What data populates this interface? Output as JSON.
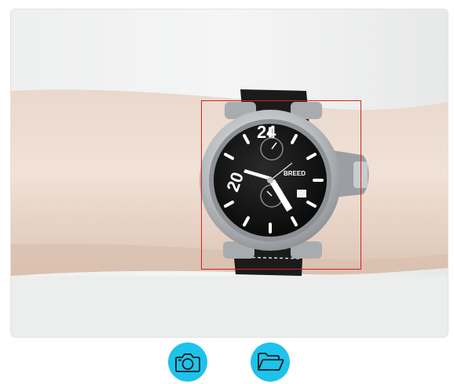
{
  "photo": {
    "subject": "wristwatch",
    "dial_numerals": [
      "24",
      "20"
    ],
    "dial_brand": "BREED"
  },
  "detection": {
    "color": "#d61f1f"
  },
  "actions": {
    "camera": {
      "icon": "camera-icon"
    },
    "folder": {
      "icon": "folder-open-icon"
    },
    "accent_color": "#1dc3eb"
  }
}
